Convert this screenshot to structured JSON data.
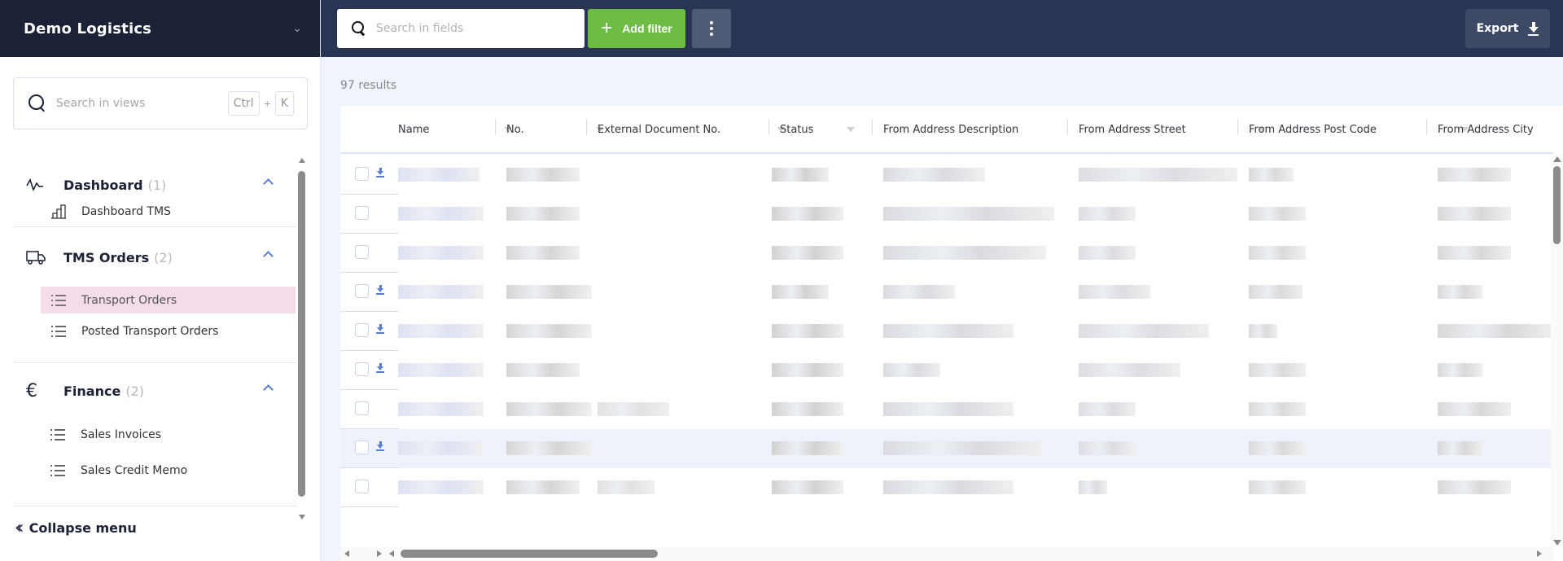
{
  "sidebar": {
    "workspace_title": "Demo Logistics",
    "search_placeholder": "Search in views",
    "shortcut_key1": "Ctrl",
    "shortcut_plus": "+",
    "shortcut_key2": "K",
    "groups": [
      {
        "title": "Dashboard",
        "count": "(1)",
        "icon": "activity-icon",
        "items": [
          {
            "label": "Dashboard TMS",
            "icon": "bar-chart-icon",
            "active": false
          }
        ]
      },
      {
        "title": "TMS Orders",
        "count": "(2)",
        "icon": "truck-icon",
        "items": [
          {
            "label": "Transport Orders",
            "icon": "list-icon",
            "active": true
          },
          {
            "label": "Posted Transport Orders",
            "icon": "list-icon",
            "active": false
          }
        ]
      },
      {
        "title": "Finance",
        "count": "(2)",
        "icon": "euro-icon",
        "items": [
          {
            "label": "Sales Invoices",
            "icon": "list-icon",
            "active": false
          },
          {
            "label": "Sales Credit Memo",
            "icon": "list-icon",
            "active": false
          }
        ]
      }
    ],
    "collapse_label": "Collapse menu"
  },
  "toolbar": {
    "search_placeholder": "Search in fields",
    "add_filter_label": "Add filter",
    "export_label": "Export"
  },
  "main": {
    "results_text": "97 results",
    "columns": [
      "Name",
      "No.",
      "External Document No.",
      "Status",
      "From Address Description",
      "From Address Street",
      "From Address Post Code",
      "From Address City"
    ],
    "rows": [
      {
        "has_download": true,
        "highlighted": false,
        "cells_redacted": true
      },
      {
        "has_download": false,
        "highlighted": false,
        "cells_redacted": true
      },
      {
        "has_download": false,
        "highlighted": false,
        "cells_redacted": true
      },
      {
        "has_download": true,
        "highlighted": false,
        "cells_redacted": true
      },
      {
        "has_download": true,
        "highlighted": false,
        "cells_redacted": true
      },
      {
        "has_download": true,
        "highlighted": false,
        "cells_redacted": true
      },
      {
        "has_download": false,
        "highlighted": false,
        "cells_redacted": true
      },
      {
        "has_download": true,
        "highlighted": true,
        "cells_redacted": true
      },
      {
        "has_download": false,
        "highlighted": false,
        "cells_redacted": true
      }
    ]
  },
  "colors": {
    "brand_bar": "#1c2236",
    "topbar": "#2a3553",
    "add_filter": "#6dbd45",
    "active_item": "#f5dceb",
    "accent": "#5c7fd1"
  }
}
